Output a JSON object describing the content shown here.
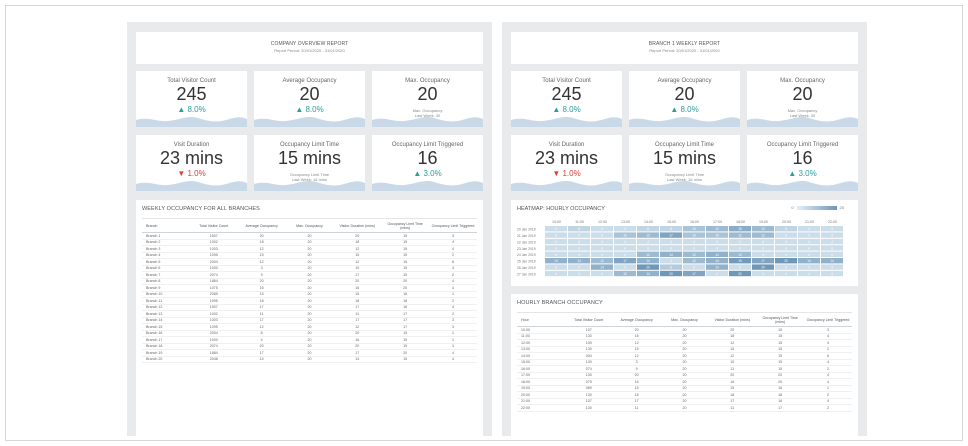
{
  "left": {
    "title": "COMPANY OVERVIEW REPORT",
    "period": "Report Period: 20/01/2020 - 31/01/2020",
    "kpis": [
      {
        "label": "Total Visitor Count",
        "value": "245",
        "change": "▲ 8.0%",
        "dir": "up",
        "note": ""
      },
      {
        "label": "Average Occupancy",
        "value": "20",
        "change": "▲ 8.0%",
        "dir": "up",
        "note": ""
      },
      {
        "label": "Max. Occupancy",
        "value": "20",
        "change": "",
        "dir": "",
        "note": "Max. Occupancy\nLast Week: 30"
      },
      {
        "label": "Visit Duration",
        "value": "23 mins",
        "change": "▼ 1.0%",
        "dir": "down",
        "note": ""
      },
      {
        "label": "Occupancy Limit Time",
        "value": "15 mins",
        "change": "",
        "dir": "",
        "note": "Occupancy Limit Time\nLast Week: 16 mins"
      },
      {
        "label": "Occupancy Limit Triggered",
        "value": "16",
        "change": "▲ 3.0%",
        "dir": "up",
        "note": ""
      }
    ],
    "table": {
      "heading": "WEEKLY OCCUPANCY FOR ALL BRANCHES",
      "columns": [
        "Branch",
        "Total Visitor Count",
        "Average Occupancy",
        "Max. Occupancy",
        "Visitor Duration (mins)",
        "Occupancy Limit Time (mins)",
        "Occupancy Limit Triggered"
      ],
      "rows": [
        [
          "Branch 1",
          "1507",
          "20",
          "20",
          "20",
          "15",
          "3"
        ],
        [
          "Branch 2",
          "1002",
          "18",
          "20",
          "18",
          "15",
          "4"
        ],
        [
          "Branch 3",
          "1003",
          "12",
          "20",
          "12",
          "15",
          "4"
        ],
        [
          "Branch 4",
          "1095",
          "15",
          "20",
          "15",
          "15",
          "2"
        ],
        [
          "Branch 5",
          "2004",
          "12",
          "20",
          "12",
          "15",
          "6"
        ],
        [
          "Branch 6",
          "1000",
          "3",
          "20",
          "10",
          "15",
          "4"
        ],
        [
          "Branch 7",
          "2074",
          "9",
          "20",
          "17",
          "15",
          "2"
        ],
        [
          "Branch 8",
          "1884",
          "20",
          "20",
          "20",
          "20",
          "4"
        ],
        [
          "Branch 9",
          "1075",
          "16",
          "20",
          "16",
          "20",
          "4"
        ],
        [
          "Branch 10",
          "2089",
          "15",
          "20",
          "15",
          "16",
          "1"
        ],
        [
          "Branch 11",
          "1095",
          "18",
          "20",
          "18",
          "18",
          "2"
        ],
        [
          "Branch 12",
          "1507",
          "17",
          "20",
          "17",
          "16",
          "4"
        ],
        [
          "Branch 13",
          "1002",
          "11",
          "20",
          "11",
          "17",
          "2"
        ],
        [
          "Branch 14",
          "1003",
          "17",
          "20",
          "17",
          "17",
          "3"
        ],
        [
          "Branch 15",
          "1095",
          "12",
          "20",
          "12",
          "17",
          "3"
        ],
        [
          "Branch 16",
          "2004",
          "8",
          "20",
          "20",
          "15",
          "1"
        ],
        [
          "Branch 17",
          "1000",
          "4",
          "20",
          "16",
          "15",
          "1"
        ],
        [
          "Branch 18",
          "2074",
          "20",
          "20",
          "20",
          "15",
          "3"
        ],
        [
          "Branch 19",
          "1884",
          "17",
          "20",
          "17",
          "20",
          "4"
        ],
        [
          "Branch 20",
          "2046",
          "14",
          "20",
          "14",
          "15",
          "4"
        ]
      ]
    }
  },
  "right": {
    "title": "BRANCH 1 WEEKLY REPORT",
    "period": "Report Period: 20/01/2020 - 31/01/2020",
    "kpis": [
      {
        "label": "Total Visitor Count",
        "value": "245",
        "change": "▲ 8.0%",
        "dir": "up",
        "note": ""
      },
      {
        "label": "Average Occupancy",
        "value": "20",
        "change": "▲ 8.0%",
        "dir": "up",
        "note": ""
      },
      {
        "label": "Max. Occupancy",
        "value": "20",
        "change": "",
        "dir": "",
        "note": "Max. Occupancy\nLast Week: 30"
      },
      {
        "label": "Visit Duration",
        "value": "23 mins",
        "change": "▼ 1.0%",
        "dir": "down",
        "note": ""
      },
      {
        "label": "Occupancy Limit Time",
        "value": "15 mins",
        "change": "",
        "dir": "",
        "note": "Occupancy Limit Time\nLast Week: 16 mins"
      },
      {
        "label": "Occupancy Limit Triggered",
        "value": "16",
        "change": "▲ 3.0%",
        "dir": "up",
        "note": ""
      }
    ],
    "heatmap": {
      "heading": "HEATMAP: HOURLY OCCUPANCY",
      "legend_min": "0",
      "legend_max": "20",
      "hours": [
        "10:00",
        "11:00",
        "12:00",
        "13:00",
        "14:00",
        "15:00",
        "16:00",
        "17:00",
        "18:00",
        "19:00",
        "20:00",
        "21:00",
        "22:00"
      ],
      "days": [
        "20 Jan 2019",
        "21 Jan 2019",
        "22 Jan 2019",
        "23 Jan 2019",
        "24 Jan 2019",
        "25 Jan 2019",
        "26 Jan 2019",
        "27 Jan 2019"
      ],
      "values": [
        [
          4,
          6,
          4,
          4,
          6,
          6,
          10,
          12,
          15,
          12,
          6,
          4,
          4
        ],
        [
          4,
          4,
          4,
          10,
          12,
          17,
          10,
          10,
          12,
          12,
          4,
          4,
          4
        ],
        [
          4,
          4,
          4,
          4,
          4,
          4,
          4,
          4,
          4,
          4,
          4,
          4,
          4
        ],
        [
          4,
          4,
          4,
          4,
          4,
          4,
          4,
          4,
          4,
          4,
          4,
          4,
          4
        ],
        [
          4,
          4,
          4,
          4,
          12,
          14,
          12,
          14,
          12,
          4,
          4,
          4,
          4
        ],
        [
          14,
          14,
          12,
          17,
          14,
          4,
          12,
          14,
          19,
          17,
          20,
          14,
          14
        ],
        [
          4,
          4,
          14,
          4,
          20,
          8,
          4,
          14,
          4,
          20,
          4,
          4,
          4
        ],
        [
          4,
          4,
          4,
          12,
          14,
          20,
          17,
          4,
          20,
          4,
          4,
          4,
          4
        ]
      ]
    },
    "table": {
      "heading": "HOURLY BRANCH OCCUPANCY",
      "columns": [
        "Hour",
        "Total Visitor Count",
        "Average Occupancy",
        "Max. Occupancy",
        "Visitor Duration (mins)",
        "Occupancy Limit Time (mins)",
        "Occupancy Limit Triggered"
      ],
      "rows": [
        [
          "10:00",
          "107",
          "20",
          "20",
          "20",
          "15",
          "3"
        ],
        [
          "11:00",
          "130",
          "18",
          "20",
          "18",
          "15",
          "4"
        ],
        [
          "12:00",
          "100",
          "12",
          "20",
          "12",
          "15",
          "4"
        ],
        [
          "13:00",
          "130",
          "15",
          "20",
          "15",
          "15",
          "2"
        ],
        [
          "14:00",
          "004",
          "12",
          "20",
          "12",
          "15",
          "6"
        ],
        [
          "15:00",
          "130",
          "3",
          "20",
          "10",
          "15",
          "4"
        ],
        [
          "16:00",
          "074",
          "9",
          "20",
          "11",
          "15",
          "2"
        ],
        [
          "17:00",
          "130",
          "20",
          "20",
          "20",
          "20",
          "4"
        ],
        [
          "18:00",
          "075",
          "16",
          "20",
          "16",
          "20",
          "4"
        ],
        [
          "19:00",
          "089",
          "15",
          "20",
          "15",
          "16",
          "1"
        ],
        [
          "20:00",
          "130",
          "18",
          "20",
          "18",
          "18",
          "2"
        ],
        [
          "21:00",
          "107",
          "17",
          "20",
          "17",
          "16",
          "4"
        ],
        [
          "22:00",
          "130",
          "11",
          "20",
          "11",
          "17",
          "2"
        ]
      ]
    }
  },
  "colors": {
    "accent": "#2a9d9d",
    "negative": "#d9413b",
    "wave": "#c9d9e8",
    "heat_low": "#e4eef6",
    "heat_high": "#6e97b8"
  }
}
